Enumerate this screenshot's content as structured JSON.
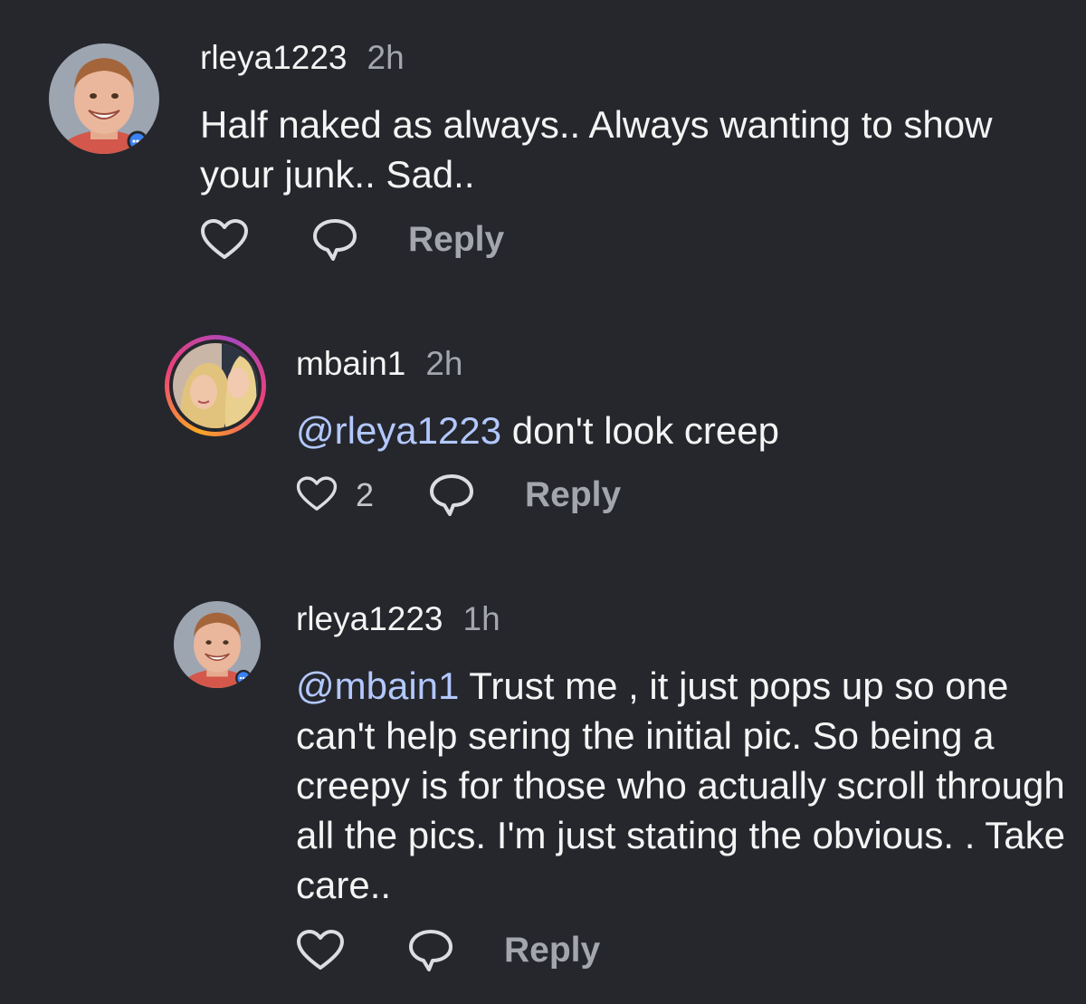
{
  "colors": {
    "background": "#25272c",
    "text": "#f4f4f4",
    "muted": "#a3a6ad",
    "mention": "#b3c8ff"
  },
  "comments": [
    {
      "username": "rleya1223",
      "time": "2h",
      "mention": "",
      "text": "Half naked as always.. Always wanting to show your junk.. Sad..",
      "likes": "",
      "reply_label": "Reply",
      "avatar_icon": "avatar-boy-photo"
    },
    {
      "username": "mbain1",
      "time": "2h",
      "mention": "@rleya1223",
      "text": " don't look creep",
      "likes": "2",
      "reply_label": "Reply",
      "avatar_icon": "avatar-two-women-photo"
    },
    {
      "username": "rleya1223",
      "time": "1h",
      "mention": "@mbain1",
      "text": " Trust me , it just pops up so one can't help sering the initial pic. So being a creepy is for those who actually scroll through all the pics. I'm just stating the obvious. . Take care..",
      "likes": "",
      "reply_label": "Reply",
      "avatar_icon": "avatar-boy-photo"
    }
  ]
}
